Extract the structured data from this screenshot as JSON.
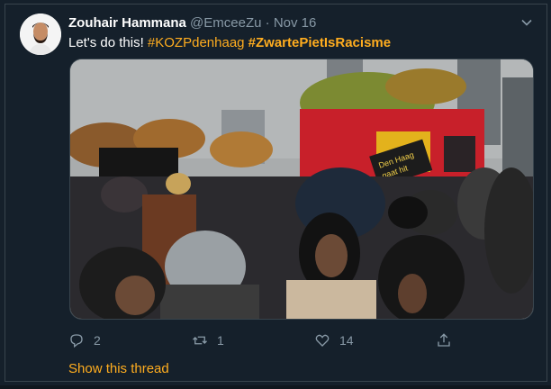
{
  "tweet": {
    "display_name": "Zouhair Hammana",
    "handle": "@EmceeZu",
    "separator": "·",
    "date": "Nov 16",
    "text_plain": "Let's do this! ",
    "hashtag1": "#KOZPdenhaag",
    "hashtag2": "#ZwartePietIsRacisme",
    "image_banner_text": "Den Haag",
    "image_banner_text2": "gaat hit",
    "actions": {
      "reply_count": "2",
      "retweet_count": "1",
      "like_count": "14"
    },
    "show_thread_label": "Show this thread"
  },
  "colors": {
    "background": "#15202b",
    "accent": "#ffad1f",
    "muted": "#8899a6",
    "border": "#38444d"
  },
  "icons": {
    "reply": "reply-icon",
    "retweet": "retweet-icon",
    "like": "heart-icon",
    "share": "share-icon",
    "menu": "chevron-down-icon"
  }
}
